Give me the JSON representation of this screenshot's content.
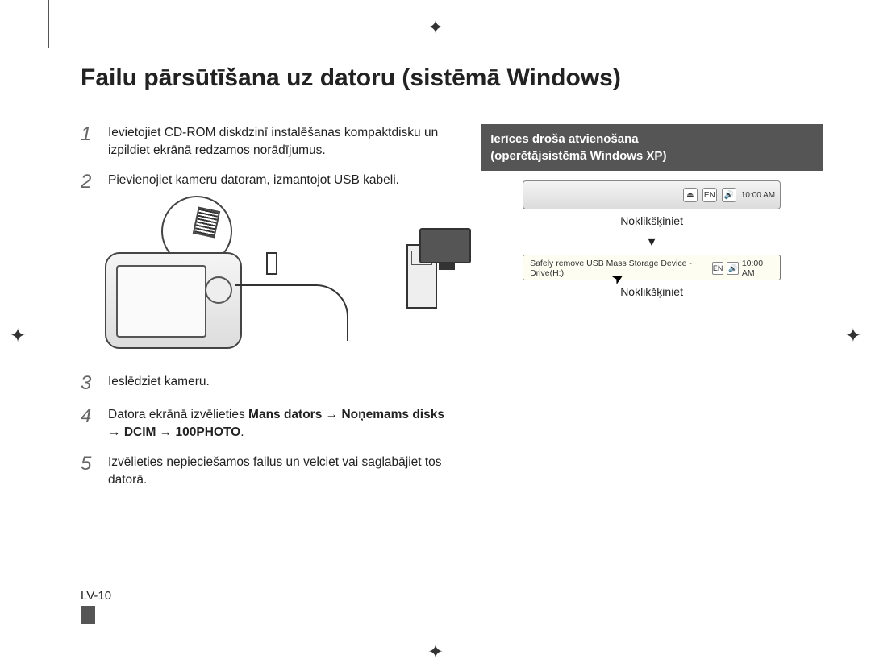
{
  "title": "Failu pārsūtīšana uz datoru (sistēmā Windows)",
  "steps": {
    "s1": {
      "num": "1",
      "text": "Ievietojiet CD-ROM diskdzinī instalēšanas kompaktdisku un izpildiet ekrānā redzamos norādījumus."
    },
    "s2": {
      "num": "2",
      "text": "Pievienojiet kameru datoram, izmantojot USB kabeli."
    },
    "s3": {
      "num": "3",
      "text": "Ieslēdziet kameru."
    },
    "s4": {
      "num": "4",
      "prefix": "Datora ekrānā izvēlieties ",
      "b1": "Mans dators",
      "arrow1": " → ",
      "b2": "Noņemams disks",
      "arrow2": " → ",
      "b3": "DCIM",
      "arrow3": " → ",
      "b4": "100PHOTO",
      "period": "."
    },
    "s5": {
      "num": "5",
      "text": "Izvēlieties nepieciešamos failus un velciet vai saglabājiet tos datorā."
    }
  },
  "sidebar": {
    "heading_line1": "Ierīces droša atvienošana",
    "heading_line2": "(operētājsistēmā Windows XP)",
    "click_label": "Noklikšķiniet",
    "balloon_text": "Safely remove USB Mass Storage Device - Drive(H:)",
    "tray_lang": "EN",
    "tray_time": "10:00 AM"
  },
  "page_number": "LV-10"
}
